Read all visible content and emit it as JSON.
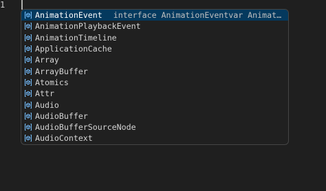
{
  "editor": {
    "line_number": "1"
  },
  "suggest": {
    "items": [
      {
        "label": "AnimationEvent",
        "icon": "symbol-variable-icon",
        "detail": "interface AnimationEventvar AnimationEvent: {"
      },
      {
        "label": "AnimationPlaybackEvent",
        "icon": "symbol-variable-icon"
      },
      {
        "label": "AnimationTimeline",
        "icon": "symbol-variable-icon"
      },
      {
        "label": "ApplicationCache",
        "icon": "symbol-variable-icon"
      },
      {
        "label": "Array",
        "icon": "symbol-variable-icon"
      },
      {
        "label": "ArrayBuffer",
        "icon": "symbol-variable-icon"
      },
      {
        "label": "Atomics",
        "icon": "symbol-variable-icon"
      },
      {
        "label": "Attr",
        "icon": "symbol-variable-icon"
      },
      {
        "label": "Audio",
        "icon": "symbol-variable-icon"
      },
      {
        "label": "AudioBuffer",
        "icon": "symbol-variable-icon"
      },
      {
        "label": "AudioBufferSourceNode",
        "icon": "symbol-variable-icon"
      },
      {
        "label": "AudioContext",
        "icon": "symbol-variable-icon"
      }
    ],
    "selected_index": 0
  },
  "colors": {
    "background": "#1f1f1f",
    "widget_background": "#202020",
    "selection": "#04395e",
    "icon": "#75beff"
  }
}
